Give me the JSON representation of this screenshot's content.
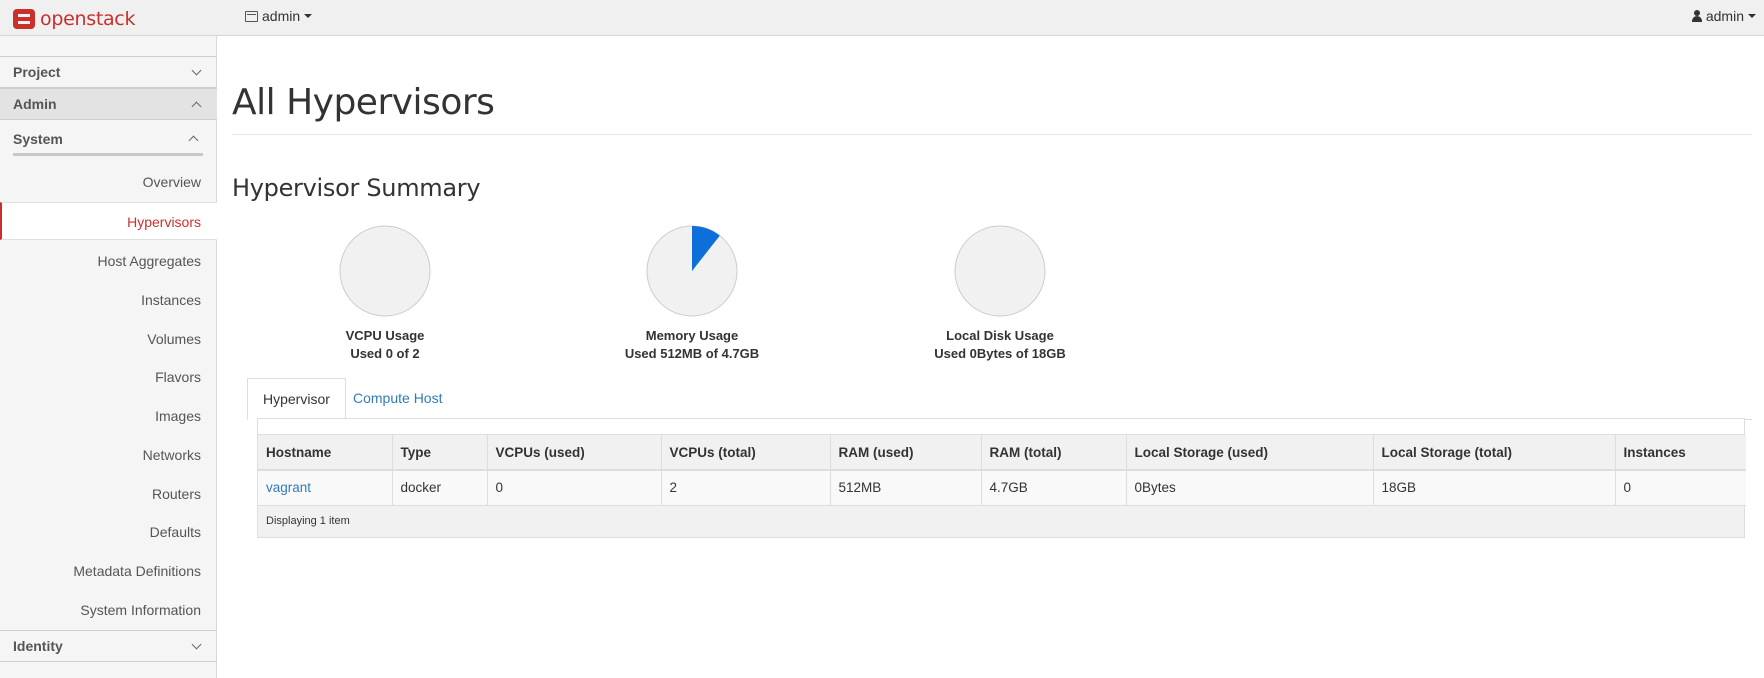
{
  "brand": {
    "name": "openstack"
  },
  "topbar": {
    "project_label": "admin",
    "user_label": "admin"
  },
  "sidebar": {
    "panels": [
      {
        "label": "Project",
        "expanded": false
      },
      {
        "label": "Admin",
        "expanded": true
      },
      {
        "label": "Identity",
        "expanded": false
      }
    ],
    "dashboard": {
      "label": "System",
      "expanded": true
    },
    "items": [
      {
        "label": "Overview"
      },
      {
        "label": "Hypervisors",
        "active": true
      },
      {
        "label": "Host Aggregates"
      },
      {
        "label": "Instances"
      },
      {
        "label": "Volumes"
      },
      {
        "label": "Flavors"
      },
      {
        "label": "Images"
      },
      {
        "label": "Networks"
      },
      {
        "label": "Routers"
      },
      {
        "label": "Defaults"
      },
      {
        "label": "Metadata Definitions"
      },
      {
        "label": "System Information"
      }
    ]
  },
  "page": {
    "title": "All Hypervisors",
    "summary_title": "Hypervisor Summary"
  },
  "usage": [
    {
      "label": "VCPU Usage",
      "sub": "Used 0 of 2",
      "used_fraction": 0
    },
    {
      "label": "Memory Usage",
      "sub": "Used 512MB of 4.7GB",
      "used_fraction": 0.106
    },
    {
      "label": "Local Disk Usage",
      "sub": "Used 0Bytes of 18GB",
      "used_fraction": 0
    }
  ],
  "colors": {
    "pie_used": "#0d6fd9",
    "pie_free": "#f1f1f1",
    "pie_border": "#cccccc",
    "accent": "#c9302c",
    "link": "#337ab7"
  },
  "tabs": [
    {
      "label": "Hypervisor",
      "active": true
    },
    {
      "label": "Compute Host",
      "active": false
    }
  ],
  "table": {
    "columns": [
      "Hostname",
      "Type",
      "VCPUs (used)",
      "VCPUs (total)",
      "RAM (used)",
      "RAM (total)",
      "Local Storage (used)",
      "Local Storage (total)",
      "Instances"
    ],
    "rows": [
      [
        "vagrant",
        "docker",
        "0",
        "2",
        "512MB",
        "4.7GB",
        "0Bytes",
        "18GB",
        "0"
      ]
    ],
    "footer": "Displaying 1 item"
  }
}
